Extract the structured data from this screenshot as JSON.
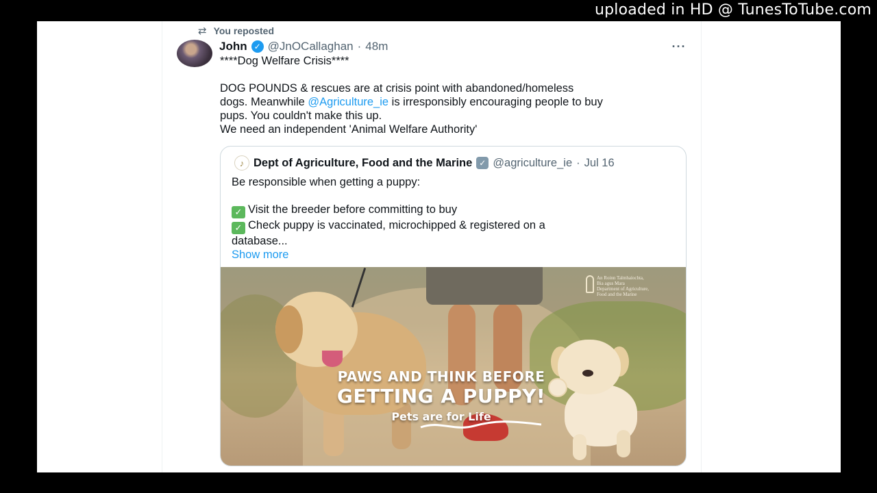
{
  "watermark": "uploaded in HD @ TunesToTube.com",
  "repost": {
    "label": "You reposted",
    "icon": "repost-icon"
  },
  "tweet": {
    "author_name": "John",
    "handle": "@JnOCallaghan",
    "separator": "·",
    "time": "48m",
    "more": "···",
    "lines": [
      "****Dog Welfare Crisis****",
      "DOG POUNDS & rescues are at crisis point with abandoned/homeless",
      "dogs. Meanwhile ",
      "@Agriculture_ie",
      " is irresponsibly encouraging people to buy",
      "pups. You couldn't make this up.",
      "We need an independent 'Animal Welfare Authority'"
    ]
  },
  "quote": {
    "author_name": "Dept of Agriculture, Food and the Marine",
    "handle": "@agriculture_ie",
    "separator": "·",
    "date": "Jul 16",
    "intro": "Be responsible when getting a puppy:",
    "items": [
      "Visit the breeder before committing to buy",
      "Check puppy is vaccinated, microchipped & registered on a"
    ],
    "continuation": "database...",
    "show_more": "Show more",
    "image": {
      "logo_lines": [
        "An Roinn Talmhaíochta,",
        "Bia agus Mara",
        "Department of Agriculture,",
        "Food and the Marine"
      ],
      "slogan_1": "PAWS AND THINK BEFORE",
      "slogan_2": "GETTING A PUPPY!",
      "slogan_3": "Pets are for Life"
    }
  },
  "colors": {
    "link": "#1d9bf0",
    "verified": "#1d9bf0",
    "muted": "#536471",
    "checkbox": "#5cb85c"
  }
}
